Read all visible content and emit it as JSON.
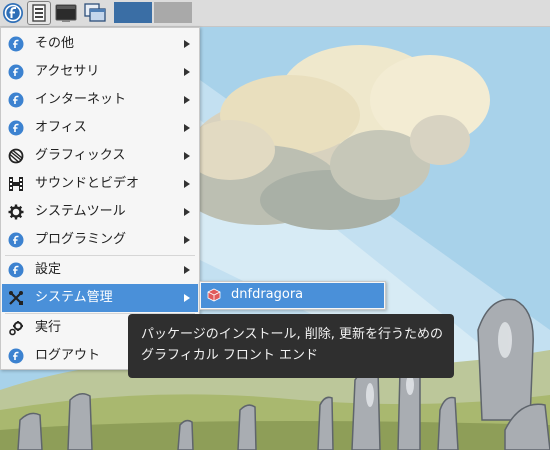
{
  "panel": {
    "launchers": [
      {
        "name": "fedora-start-menu-icon"
      },
      {
        "name": "file-manager-icon"
      },
      {
        "name": "terminal-icon"
      },
      {
        "name": "show-desktop-icon"
      }
    ],
    "workspaces": [
      {
        "color": "#3a6ea5",
        "active": true
      },
      {
        "color": "#a9a9a9",
        "active": false
      }
    ]
  },
  "menu": {
    "items": [
      {
        "label": "その他",
        "icon": "fedora-icon",
        "has_submenu": true
      },
      {
        "label": "アクセサリ",
        "icon": "fedora-icon",
        "has_submenu": true
      },
      {
        "label": "インターネット",
        "icon": "fedora-icon",
        "has_submenu": true
      },
      {
        "label": "オフィス",
        "icon": "fedora-icon",
        "has_submenu": true
      },
      {
        "label": "グラフィックス",
        "icon": "graphics-palette-icon",
        "has_submenu": true
      },
      {
        "label": "サウンドとビデオ",
        "icon": "film-strip-icon",
        "has_submenu": true
      },
      {
        "label": "システムツール",
        "icon": "gear-icon",
        "has_submenu": true
      },
      {
        "label": "プログラミング",
        "icon": "fedora-icon",
        "has_submenu": true
      },
      {
        "label": "設定",
        "icon": "fedora-icon",
        "has_submenu": true
      },
      {
        "label": "システム管理",
        "icon": "tools-icon",
        "has_submenu": true,
        "active": true
      },
      {
        "label": "実行",
        "icon": "run-gears-icon",
        "has_submenu": false
      },
      {
        "label": "ログアウト",
        "icon": "fedora-icon",
        "has_submenu": false
      }
    ]
  },
  "submenu": {
    "items": [
      {
        "label": "dnfdragora",
        "icon": "package-cube-icon"
      }
    ]
  },
  "tooltip": {
    "line1": "パッケージのインストール, 削除, 更新を行うための",
    "line2": "グラフィカル フロント エンド"
  },
  "colors": {
    "highlight": "#4a90d9",
    "panel": "#dcdcdc",
    "menu_bg": "#f6f6f6",
    "tooltip_bg": "#2f2f2f"
  }
}
